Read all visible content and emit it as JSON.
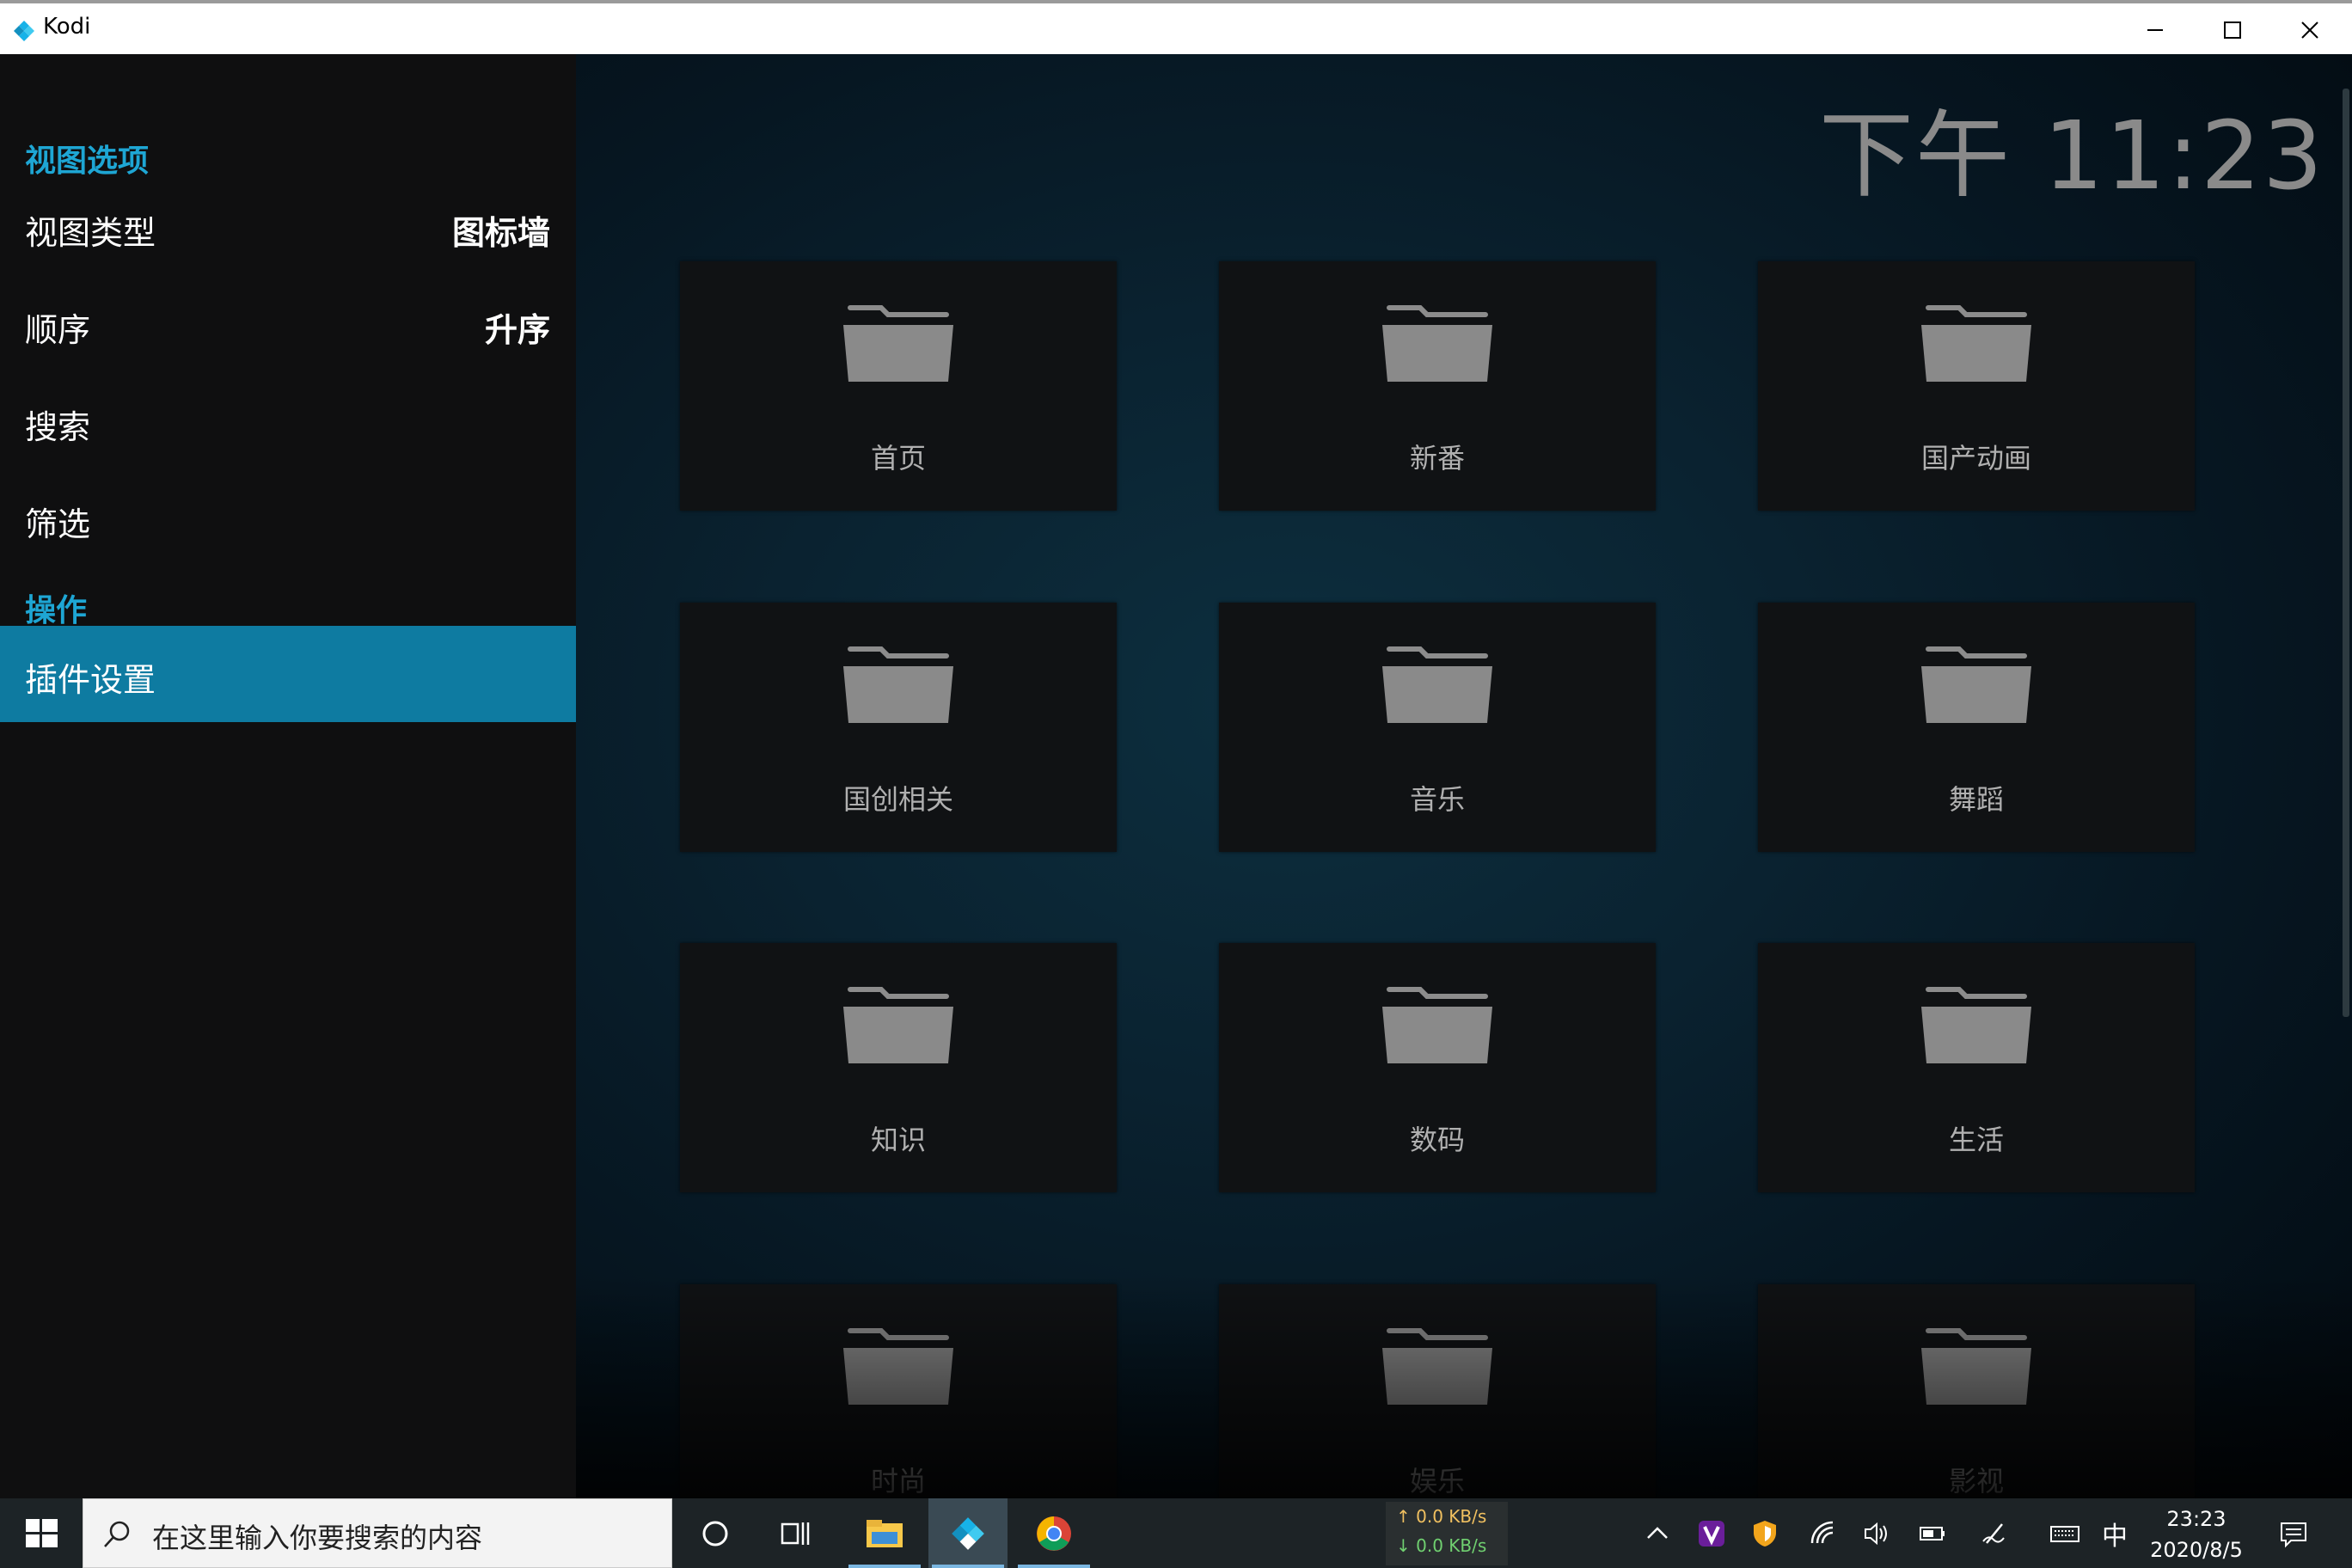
{
  "window": {
    "title": "Kodi"
  },
  "clock": "下午 11:23",
  "sidebar": {
    "section_view": "视图选项",
    "section_actions": "操作",
    "items": [
      {
        "label": "视图类型",
        "value": "图标墙"
      },
      {
        "label": "顺序",
        "value": "升序"
      },
      {
        "label": "搜索",
        "value": ""
      },
      {
        "label": "筛选",
        "value": ""
      }
    ],
    "action_items": [
      {
        "label": "插件设置",
        "active": true
      }
    ]
  },
  "folders": [
    "首页",
    "新番",
    "国产动画",
    "国创相关",
    "音乐",
    "舞蹈",
    "知识",
    "数码",
    "生活",
    "时尚",
    "娱乐",
    "影视"
  ],
  "taskbar": {
    "search_placeholder": "在这里输入你要搜索的内容",
    "net_up": "↑ 0.0 KB/s",
    "net_down": "↓ 0.0 KB/s",
    "ime": "中",
    "time": "23:23",
    "date": "2020/8/5"
  },
  "colors": {
    "accent": "#1ea6d4",
    "selection": "#0e7ba1",
    "tile_bg": "#101214"
  }
}
